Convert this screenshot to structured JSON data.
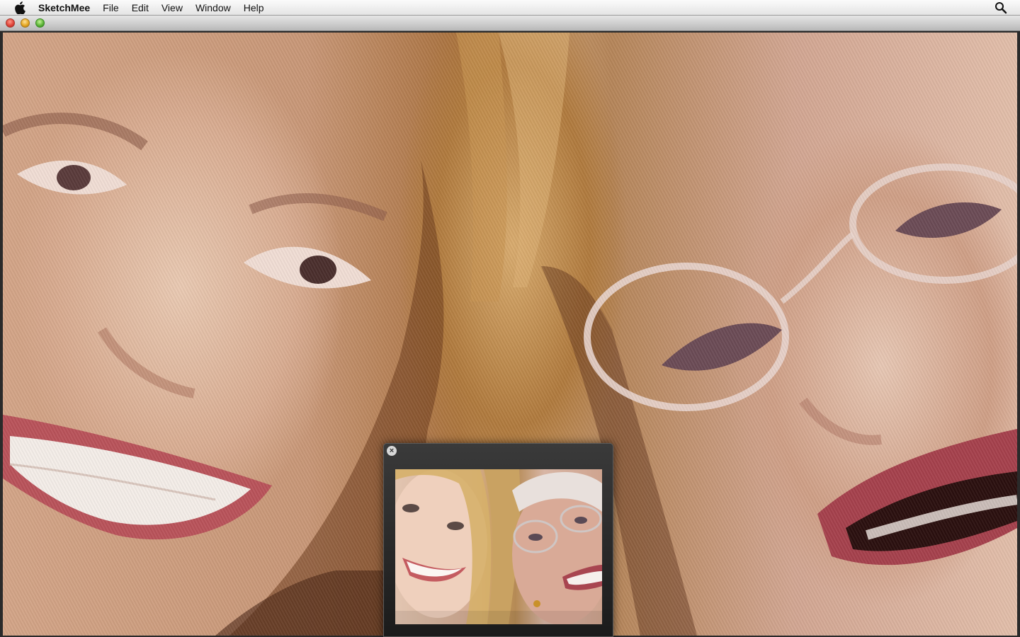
{
  "menubar": {
    "app_name": "SketchMee",
    "items": [
      "File",
      "Edit",
      "View",
      "Window",
      "Help"
    ]
  },
  "icons": {
    "apple": "apple-icon",
    "spotlight": "search-icon",
    "hud_close": "close-icon"
  },
  "preview": {
    "close_glyph": "×"
  },
  "colors": {
    "close": "#e0443a",
    "minimize": "#e6a721",
    "zoom": "#5fb63a"
  }
}
